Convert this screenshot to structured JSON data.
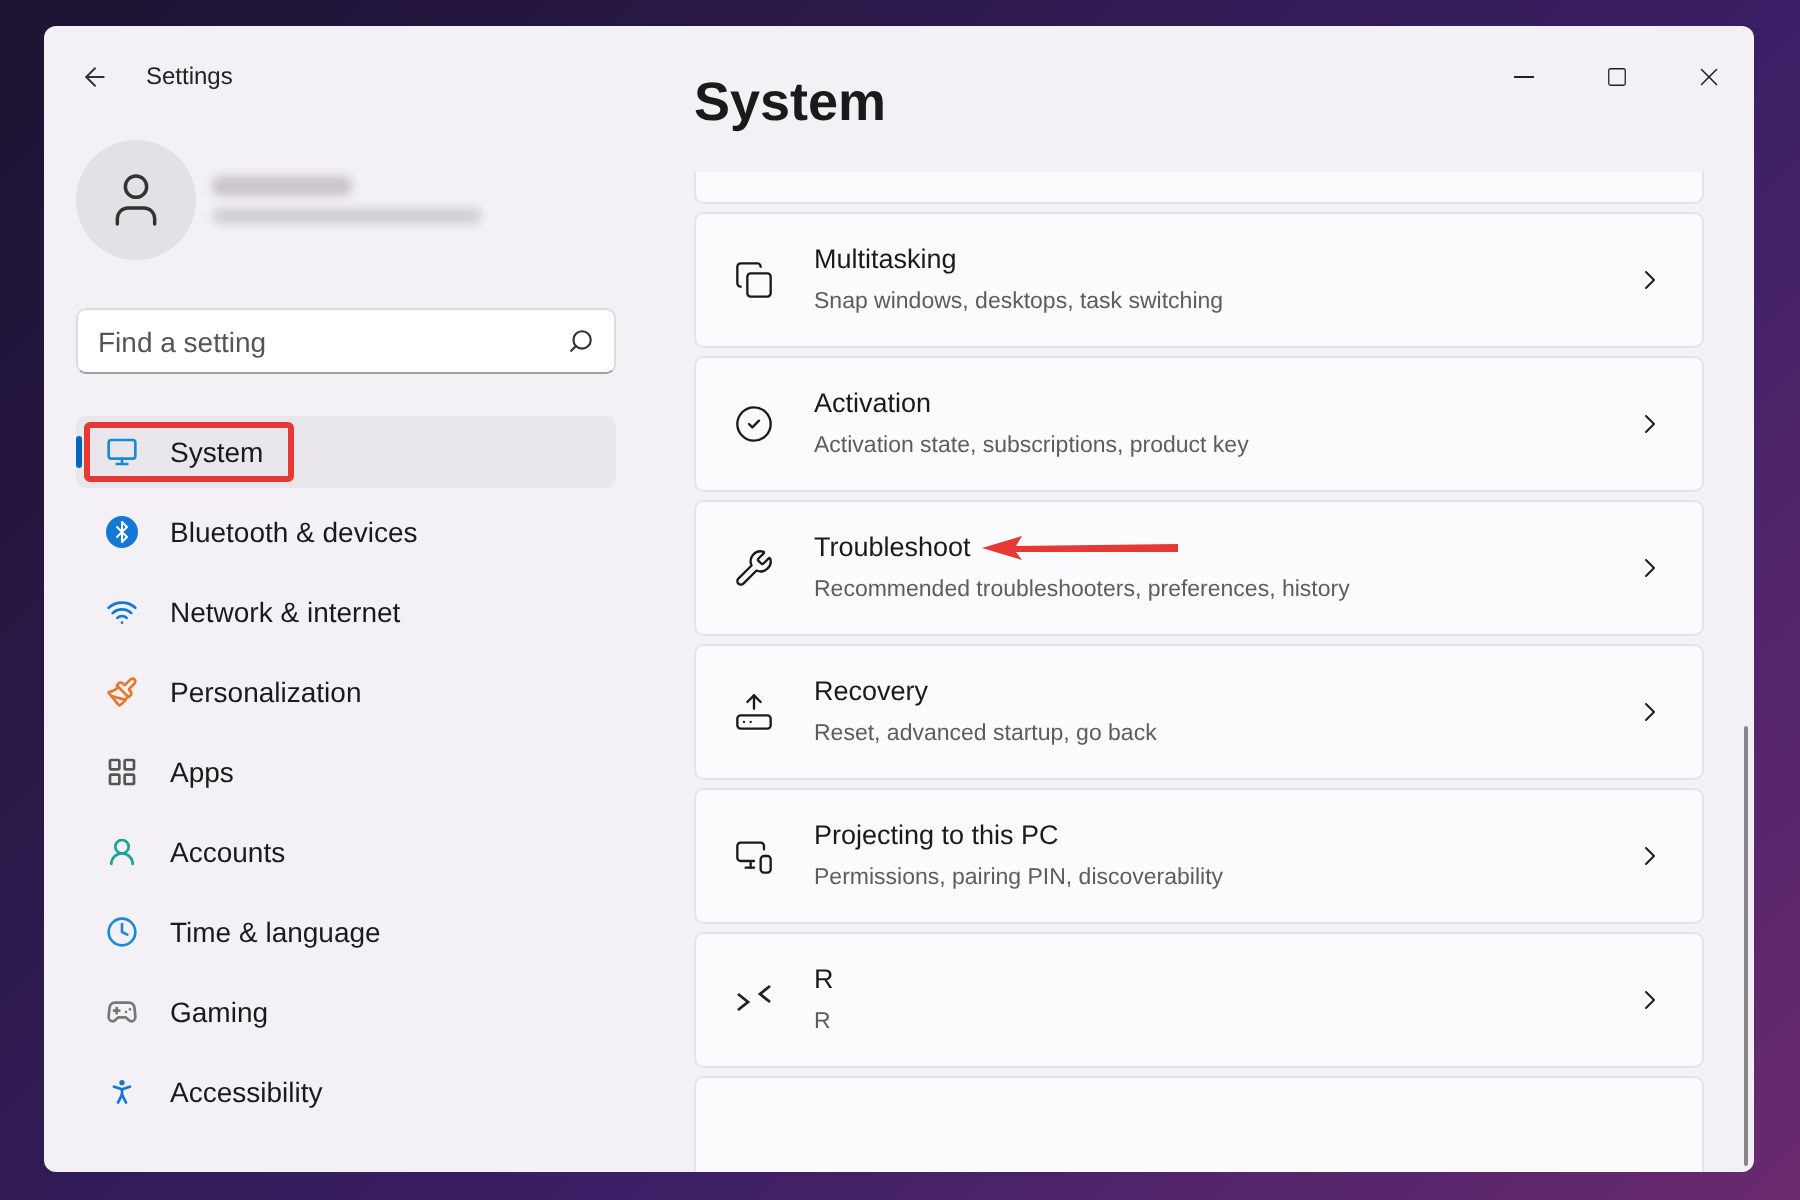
{
  "window": {
    "title": "Settings"
  },
  "search": {
    "placeholder": "Find a setting"
  },
  "sidebar": {
    "items": [
      {
        "label": "System",
        "selected": true,
        "highlighted": true
      },
      {
        "label": "Bluetooth & devices",
        "selected": false,
        "highlighted": false
      },
      {
        "label": "Network & internet",
        "selected": false,
        "highlighted": false
      },
      {
        "label": "Personalization",
        "selected": false,
        "highlighted": false
      },
      {
        "label": "Apps",
        "selected": false,
        "highlighted": false
      },
      {
        "label": "Accounts",
        "selected": false,
        "highlighted": false
      },
      {
        "label": "Time & language",
        "selected": false,
        "highlighted": false
      },
      {
        "label": "Gaming",
        "selected": false,
        "highlighted": false
      },
      {
        "label": "Accessibility",
        "selected": false,
        "highlighted": false
      }
    ]
  },
  "page": {
    "heading": "System",
    "cards": [
      {
        "title": "Multitasking",
        "subtitle": "Snap windows, desktops, task switching",
        "pointed": false
      },
      {
        "title": "Activation",
        "subtitle": "Activation state, subscriptions, product key",
        "pointed": false
      },
      {
        "title": "Troubleshoot",
        "subtitle": "Recommended troubleshooters, preferences, history",
        "pointed": true
      },
      {
        "title": "Recovery",
        "subtitle": "Reset, advanced startup, go back",
        "pointed": false
      },
      {
        "title": "Projecting to this PC",
        "subtitle": "Permissions, pairing PIN, discoverability",
        "pointed": false
      },
      {
        "title": "R",
        "subtitle": "R",
        "pointed": false
      }
    ]
  }
}
